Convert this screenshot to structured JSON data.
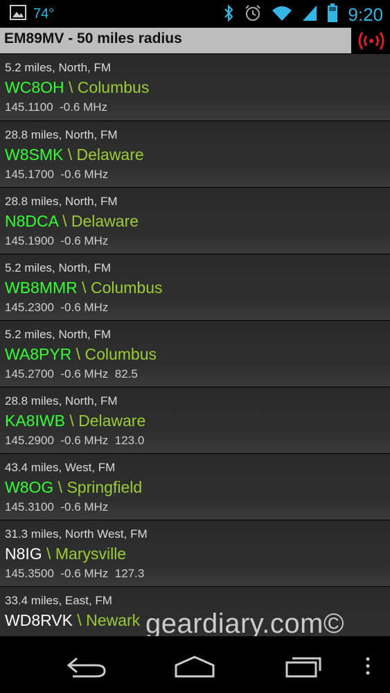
{
  "status_bar": {
    "temperature": "74°",
    "time": "9:20",
    "icons": [
      "image-icon",
      "bluetooth-icon",
      "alarm-icon",
      "wifi-icon",
      "signal-icon",
      "battery-icon"
    ]
  },
  "header": {
    "title": "EM89MV - 50 miles radius",
    "icon": "broadcast-icon",
    "icon_color": "#e02020"
  },
  "repeaters": [
    {
      "info": "5.2 miles, North, FM",
      "call": "WC8OH",
      "city": "Columbus",
      "freq": "145.1100  -0.6 MHz",
      "call_color": "green"
    },
    {
      "info": "28.8 miles, North, FM",
      "call": "W8SMK",
      "city": "Delaware",
      "freq": "145.1700  -0.6 MHz",
      "call_color": "green"
    },
    {
      "info": "28.8 miles, North, FM",
      "call": "N8DCA",
      "city": "Delaware",
      "freq": "145.1900  -0.6 MHz",
      "call_color": "green"
    },
    {
      "info": "5.2 miles, North, FM",
      "call": "WB8MMR",
      "city": "Columbus",
      "freq": "145.2300  -0.6 MHz",
      "call_color": "green"
    },
    {
      "info": "5.2 miles, North, FM",
      "call": "WA8PYR",
      "city": "Columbus",
      "freq": "145.2700  -0.6 MHz  82.5",
      "call_color": "green"
    },
    {
      "info": "28.8 miles, North, FM",
      "call": "KA8IWB",
      "city": "Delaware",
      "freq": "145.2900  -0.6 MHz  123.0",
      "call_color": "green"
    },
    {
      "info": "43.4 miles, West, FM",
      "call": "W8OG",
      "city": "Springfield",
      "freq": "145.3100  -0.6 MHz",
      "call_color": "green"
    },
    {
      "info": "31.3 miles, North West, FM",
      "call": "N8IG",
      "city": "Marysville",
      "freq": "145.3500  -0.6 MHz  127.3",
      "call_color": "white"
    },
    {
      "info": "33.4 miles, East, FM",
      "call": "WD8RVK",
      "city": "Newark",
      "freq": "",
      "call_color": "white"
    }
  ],
  "separator": "\\",
  "watermark": "geardiary.com©",
  "nav_bar": {
    "buttons": [
      "back-icon",
      "home-icon",
      "recent-apps-icon",
      "overflow-menu-icon"
    ]
  },
  "colors": {
    "accent": "#33b5e5",
    "callsign_green": "#33ff33",
    "city_green": "#9acd32",
    "header_bg": "#bdbdbd"
  }
}
